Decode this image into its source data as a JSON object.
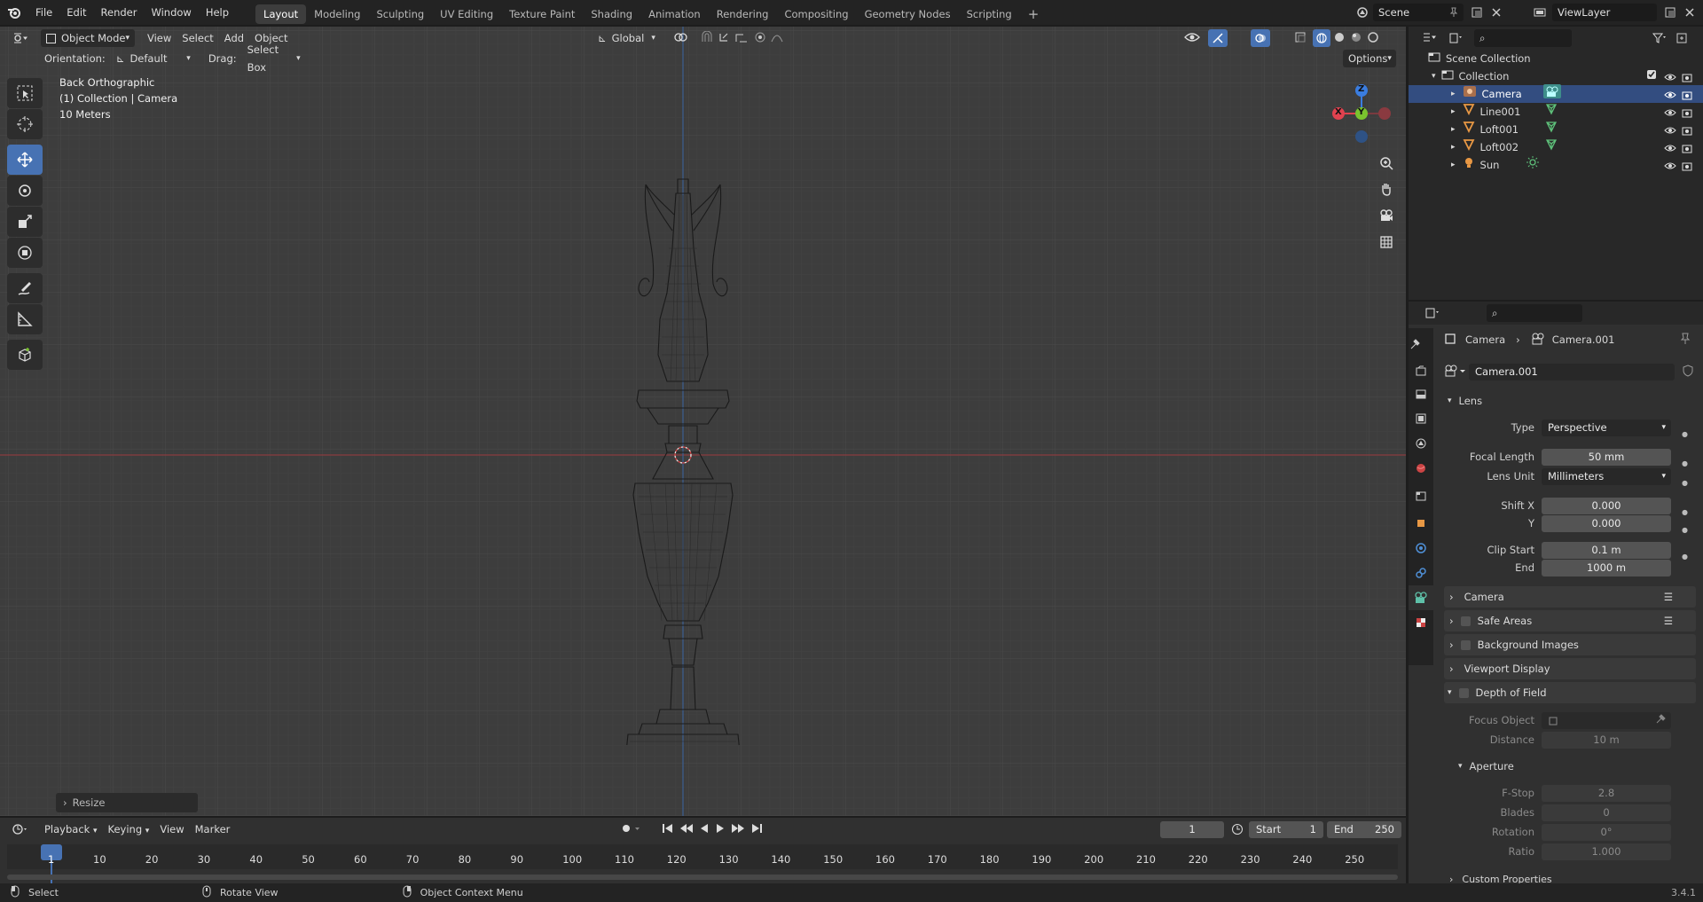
{
  "menu": {
    "items": [
      "File",
      "Edit",
      "Render",
      "Window",
      "Help"
    ],
    "workspaces": [
      "Layout",
      "Modeling",
      "Sculpting",
      "UV Editing",
      "Texture Paint",
      "Shading",
      "Animation",
      "Rendering",
      "Compositing",
      "Geometry Nodes",
      "Scripting"
    ],
    "add_tab": "+",
    "scene": "Scene",
    "view_layer": "ViewLayer"
  },
  "viewport": {
    "mode": "Object Mode",
    "menus": [
      "View",
      "Select",
      "Add",
      "Object"
    ],
    "transform_orientation": "Global",
    "orientation_label": "Orientation:",
    "orientation_value": "Default",
    "drag_label": "Drag:",
    "drag_value": "Select Box",
    "options": "Options",
    "overlay_view": "Back Orthographic",
    "overlay_collection": "(1) Collection | Camera",
    "overlay_scale": "10 Meters",
    "gizmo": {
      "z": "Z",
      "y": "Y",
      "x": "X"
    },
    "last_op": "Resize"
  },
  "outliner": {
    "root": "Scene Collection",
    "collection": "Collection",
    "objects": [
      {
        "name": "Camera",
        "type": "camera",
        "selected": true
      },
      {
        "name": "Line001",
        "type": "mesh",
        "selected": false
      },
      {
        "name": "Loft001",
        "type": "mesh",
        "selected": false
      },
      {
        "name": "Loft002",
        "type": "mesh",
        "selected": false
      },
      {
        "name": "Sun",
        "type": "light",
        "selected": false
      }
    ]
  },
  "properties": {
    "breadcrumb_object": "Camera",
    "breadcrumb_data": "Camera.001",
    "datablock": "Camera.001",
    "lens_panel": "Lens",
    "type_label": "Type",
    "type_value": "Perspective",
    "focal_label": "Focal Length",
    "focal_value": "50 mm",
    "lens_unit_label": "Lens Unit",
    "lens_unit_value": "Millimeters",
    "shift_x_label": "Shift X",
    "shift_x_value": "0.000",
    "shift_y_label": "Y",
    "shift_y_value": "0.000",
    "clip_start_label": "Clip Start",
    "clip_start_value": "0.1 m",
    "clip_end_label": "End",
    "clip_end_value": "1000 m",
    "panels": [
      "Camera",
      "Safe Areas",
      "Background Images",
      "Viewport Display",
      "Depth of Field"
    ],
    "focus_object_label": "Focus Object",
    "distance_label": "Distance",
    "distance_value": "10 m",
    "aperture_panel": "Aperture",
    "fstop_label": "F-Stop",
    "fstop_value": "2.8",
    "blades_label": "Blades",
    "blades_value": "0",
    "rotation_label": "Rotation",
    "rotation_value": "0°",
    "ratio_label": "Ratio",
    "ratio_value": "1.000",
    "custom_panel": "Custom Properties"
  },
  "timeline": {
    "menus": [
      "Playback",
      "Keying",
      "View",
      "Marker"
    ],
    "current_frame": "1",
    "start_label": "Start",
    "start_value": "1",
    "end_label": "End",
    "end_value": "250",
    "frame_marks": [
      "1",
      "10",
      "20",
      "30",
      "40",
      "50",
      "60",
      "70",
      "80",
      "90",
      "100",
      "110",
      "120",
      "130",
      "140",
      "150",
      "160",
      "170",
      "180",
      "190",
      "200",
      "210",
      "220",
      "230",
      "240",
      "250"
    ]
  },
  "status": {
    "select": "Select",
    "rotate": "Rotate View",
    "context": "Object Context Menu",
    "version": "3.4.1"
  },
  "colors": {
    "accent": "#4772b3",
    "x_axis": "#e0424f",
    "y_axis": "#7ac32e",
    "z_axis": "#3a7de0",
    "selected_row": "#334d80"
  }
}
